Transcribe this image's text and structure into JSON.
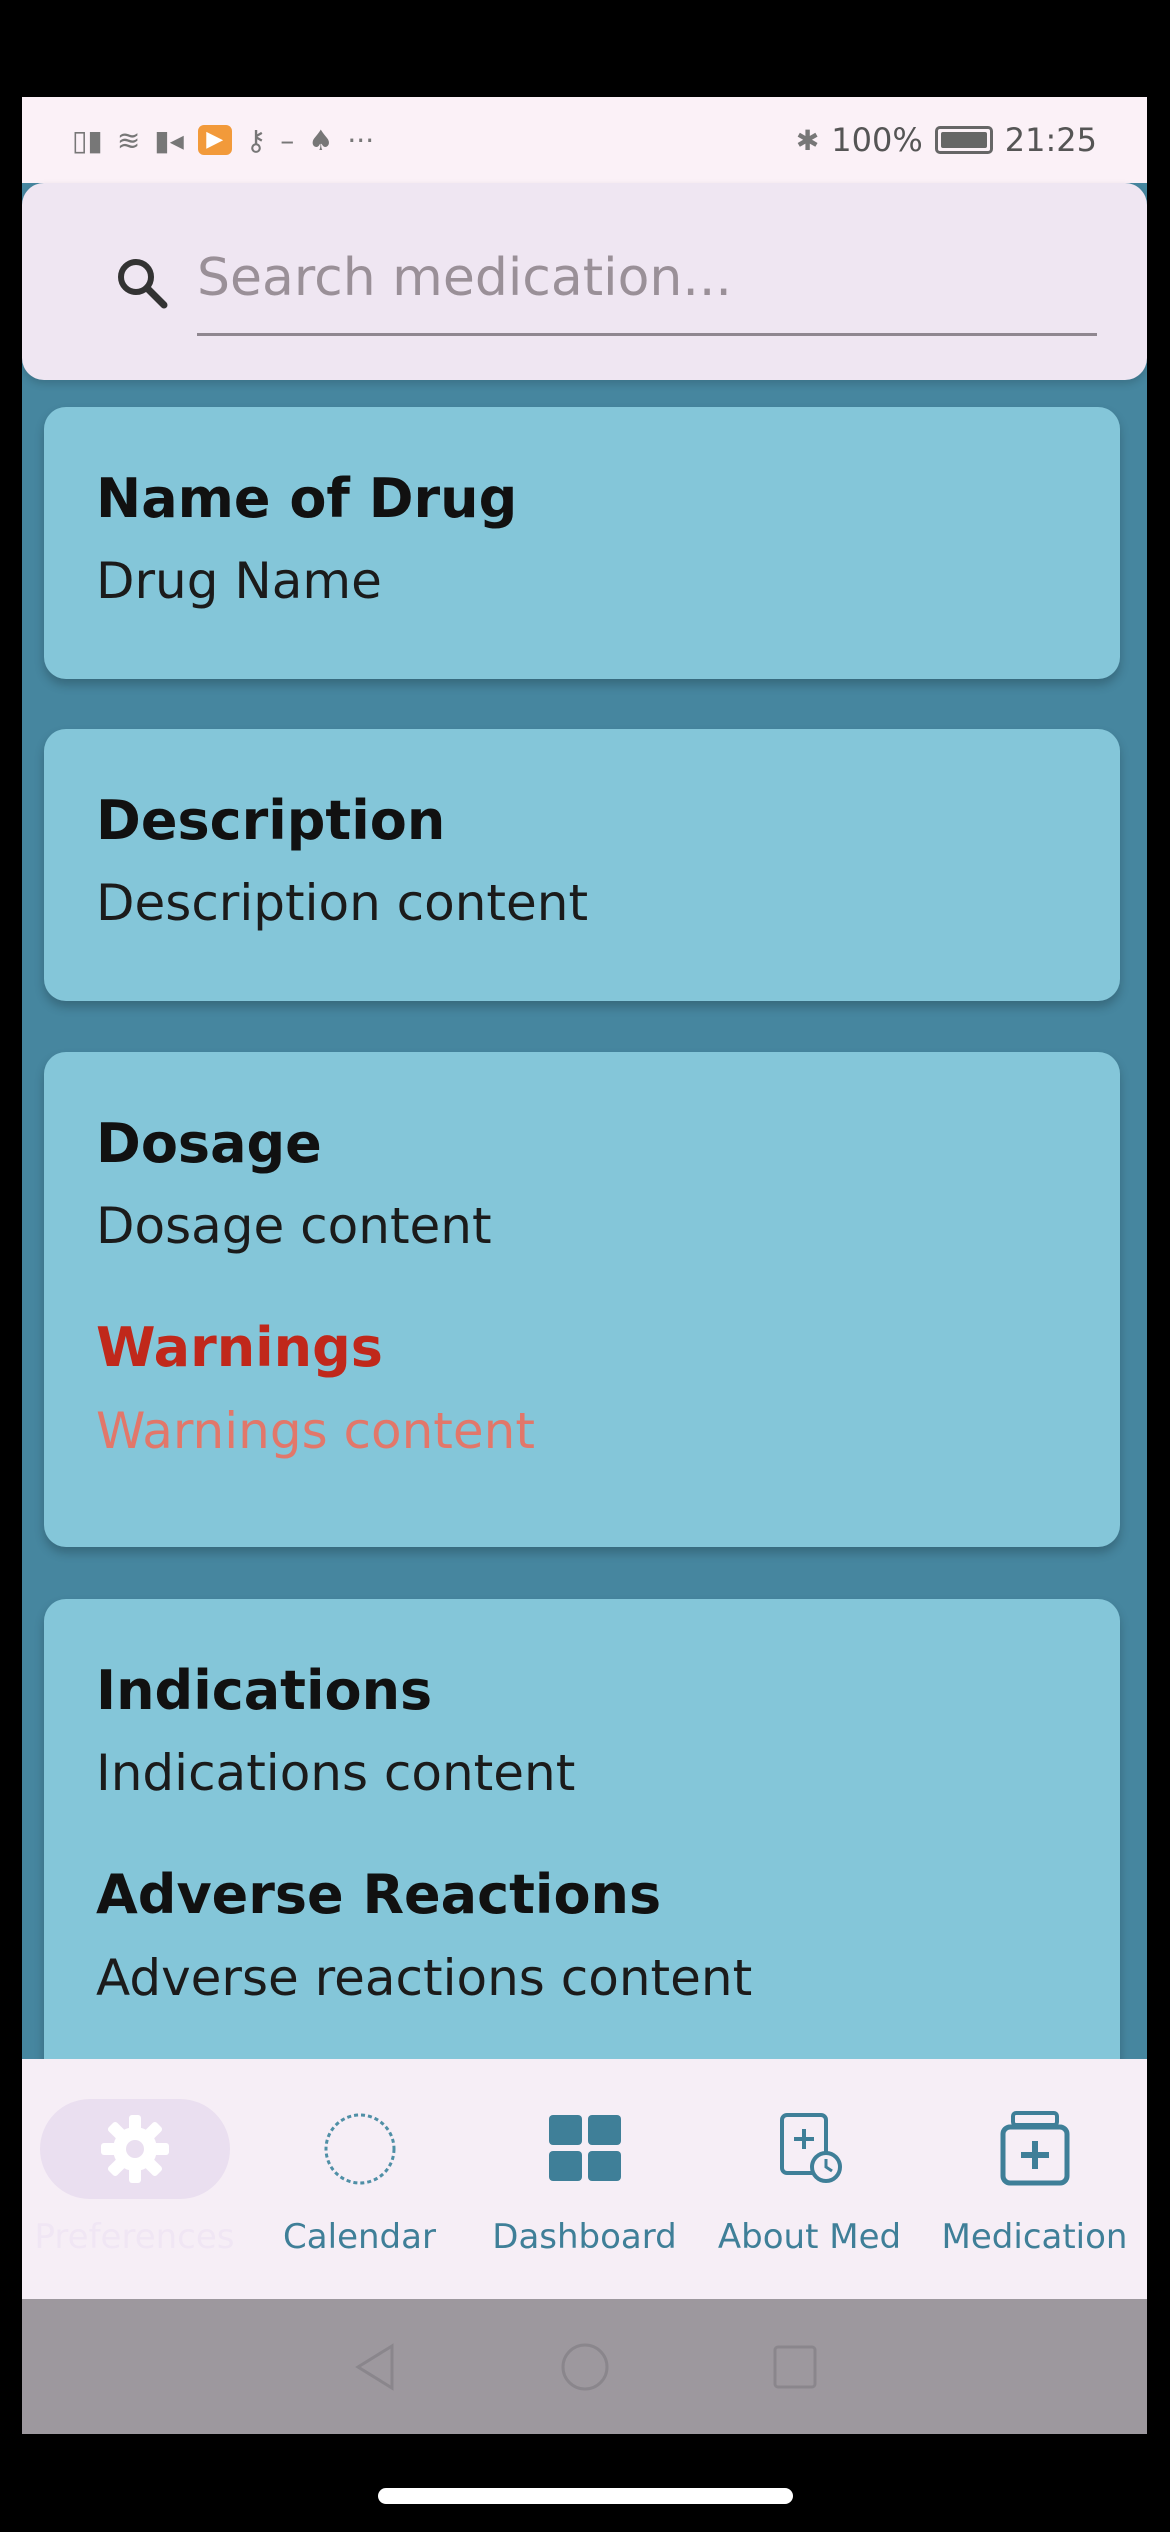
{
  "status_bar": {
    "battery": "100%",
    "time": "21:25",
    "left_icons": [
      "signal-icon",
      "wifi-icon",
      "video-icon",
      "play-app-icon",
      "key-icon",
      "dash-icon",
      "flame-icon",
      "more-icon"
    ]
  },
  "search": {
    "placeholder": "Search medication..."
  },
  "cards": {
    "name": {
      "title": "Name of Drug",
      "value": "Drug Name"
    },
    "description": {
      "title": "Description",
      "value": "Description content"
    },
    "dosage": {
      "title": "Dosage",
      "value": "Dosage content"
    },
    "warnings": {
      "title": "Warnings",
      "value": "Warnings content"
    },
    "indications": {
      "title": "Indications",
      "value": "Indications content"
    },
    "adverse": {
      "title": "Adverse Reactions",
      "value": "Adverse reactions content"
    }
  },
  "bottom_nav": {
    "items": [
      {
        "label": "Preferences",
        "icon": "gear-icon",
        "active": true
      },
      {
        "label": "Calendar",
        "icon": "circle-icon",
        "active": false
      },
      {
        "label": "Dashboard",
        "icon": "grid-icon",
        "active": false
      },
      {
        "label": "About Med",
        "icon": "med-info-icon",
        "active": false
      },
      {
        "label": "Medication",
        "icon": "medicine-box-icon",
        "active": false
      }
    ]
  },
  "colors": {
    "background": "#46869f",
    "card": "#84c6d9",
    "warning_title": "#c0281b",
    "warning_text": "#e2776a",
    "nav_accent": "#3f7f98"
  }
}
